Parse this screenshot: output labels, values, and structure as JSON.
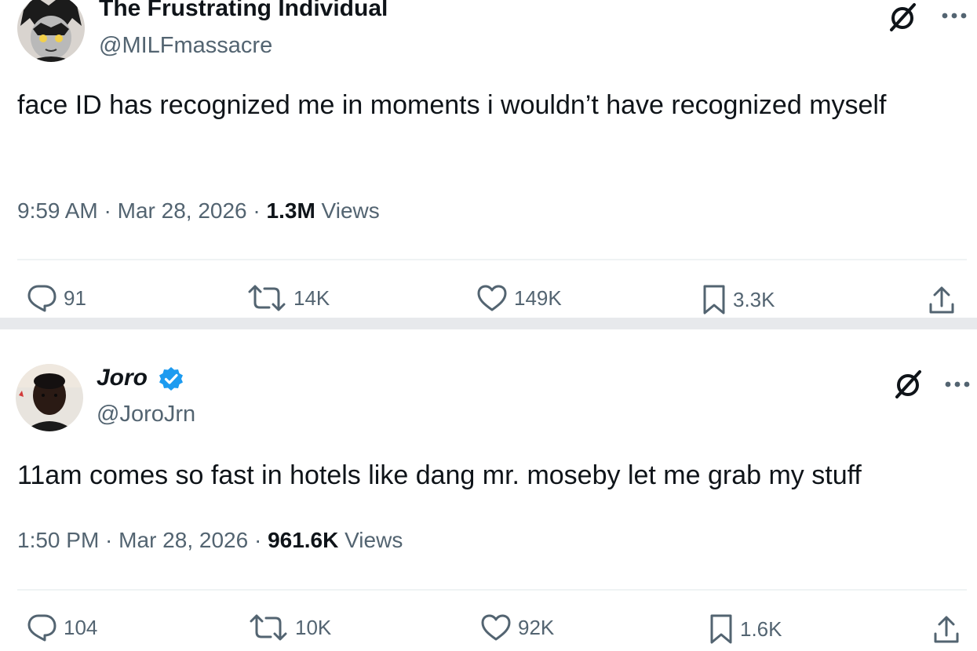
{
  "tweets": [
    {
      "author_name": "The Frustrating Individual",
      "handle": "@MILFmassacre",
      "verified": false,
      "text": "face ID has recognized me in moments i wouldn’t have recognized myself",
      "time": "9:59 AM",
      "date": "Mar 28, 2026",
      "views_count": "1.3M",
      "views_label": "Views",
      "replies": "91",
      "retweets": "14K",
      "likes": "149K",
      "bookmarks": "3.3K"
    },
    {
      "author_name": "Joro",
      "handle": "@JoroJrn",
      "verified": true,
      "text": "11am comes so fast in hotels like dang mr. moseby let me grab my stuff",
      "time": "1:50 PM",
      "date": "Mar 28, 2026",
      "views_count": "961.6K",
      "views_label": "Views",
      "replies": "104",
      "retweets": "10K",
      "likes": "92K",
      "bookmarks": "1.6K"
    }
  ],
  "separator": " · ",
  "colors": {
    "text": "#0f1419",
    "secondary": "#536471",
    "verified": "#1d9bf0",
    "divider": "#eff3f4"
  },
  "icons": [
    "grok-icon",
    "more-icon",
    "reply-icon",
    "retweet-icon",
    "like-icon",
    "bookmark-icon",
    "share-icon",
    "verified-badge-icon"
  ]
}
